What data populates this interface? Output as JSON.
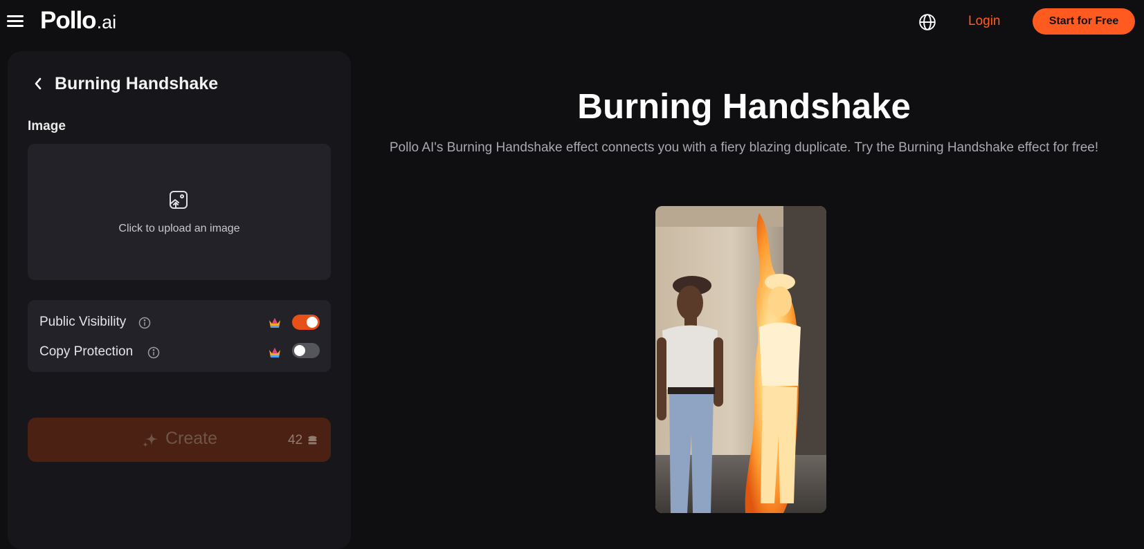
{
  "header": {
    "logo_main": "Pollo",
    "logo_suffix": ".ai",
    "login_label": "Login",
    "start_label": "Start for Free",
    "accent_color": "#ff5a1f",
    "icons": [
      "menu-icon",
      "globe-icon"
    ]
  },
  "panel": {
    "title": "Burning Handshake",
    "image_label": "Image",
    "upload_text": "Click to upload an image",
    "settings": [
      {
        "label": "Public Visibility",
        "enabled": true
      },
      {
        "label": "Copy Protection",
        "enabled": false
      }
    ],
    "create_label": "Create",
    "credits": "42"
  },
  "main": {
    "title": "Burning Handshake",
    "description": "Pollo AI's Burning Handshake effect connects you with a fiery blazing duplicate. Try the Burning Handshake effect for free!"
  }
}
